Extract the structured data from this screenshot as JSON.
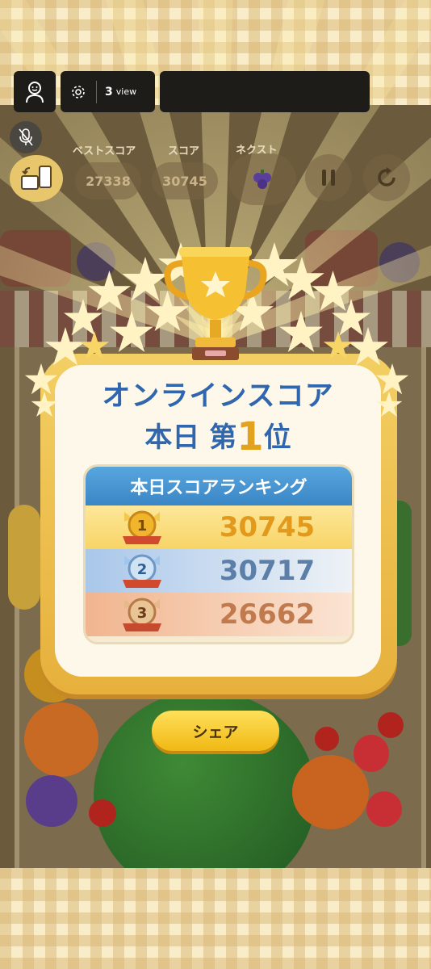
{
  "toolbar": {
    "viewer_count": "3",
    "viewer_label": "view"
  },
  "hud": {
    "best_label": "ベストスコア",
    "best_value": "27338",
    "score_label": "スコア",
    "score_value": "30745",
    "next_label": "ネクスト"
  },
  "modal": {
    "title_line1": "オンラインスコア",
    "title_day": "本日 第",
    "title_rank": "1",
    "title_suffix": "位",
    "ranking_header": "本日スコアランキング",
    "ranking": [
      {
        "rank": "1",
        "score": "30745"
      },
      {
        "rank": "2",
        "score": "30717"
      },
      {
        "rank": "3",
        "score": "26662"
      }
    ],
    "share_label": "シェア"
  },
  "colors": {
    "panel_gold": "#f0c350",
    "title_blue": "#2f66ad",
    "rank1_text": "#e39a1c",
    "rank2_text": "#5b7fa8",
    "rank3_text": "#c07a4d"
  },
  "icons": [
    "person-icon",
    "gear-icon",
    "mic-off-icon",
    "screen-switch-icon",
    "pause-icon",
    "restart-icon",
    "grape-icon",
    "trophy-icon",
    "medal-gold-icon",
    "medal-silver-icon",
    "medal-bronze-icon"
  ]
}
